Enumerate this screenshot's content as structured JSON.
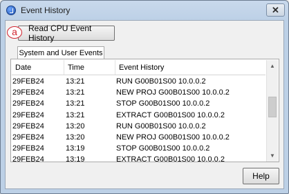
{
  "window": {
    "title": "Event History",
    "close_glyph": "✕"
  },
  "annotation": {
    "label": "a"
  },
  "toolbar": {
    "read_button_label": "Read CPU Event History"
  },
  "tabs": [
    {
      "label": "System and User Events"
    }
  ],
  "table": {
    "columns": [
      "Date",
      "Time",
      "Event History"
    ],
    "rows": [
      {
        "date": "29FEB24",
        "time": "13:21",
        "event": "RUN  G00B01S00 10.0.0.2"
      },
      {
        "date": "29FEB24",
        "time": "13:21",
        "event": "NEW PROJ G00B01S00 10.0.0.2"
      },
      {
        "date": "29FEB24",
        "time": "13:21",
        "event": "STOP G00B01S00 10.0.0.2"
      },
      {
        "date": "29FEB24",
        "time": "13:21",
        "event": "EXTRACT G00B01S00 10.0.0.2"
      },
      {
        "date": "29FEB24",
        "time": "13:20",
        "event": "RUN  G00B01S00 10.0.0.2"
      },
      {
        "date": "29FEB24",
        "time": "13:20",
        "event": "NEW PROJ G00B01S00 10.0.0.2"
      },
      {
        "date": "29FEB24",
        "time": "13:19",
        "event": "STOP G00B01S00 10.0.0.2"
      },
      {
        "date": "29FEB24",
        "time": "13:19",
        "event": "EXTRACT G00B01S00 10.0.0.2"
      }
    ]
  },
  "footer": {
    "help_label": "Help"
  },
  "icons": {
    "scroll_up": "▲",
    "scroll_down": "▼"
  }
}
